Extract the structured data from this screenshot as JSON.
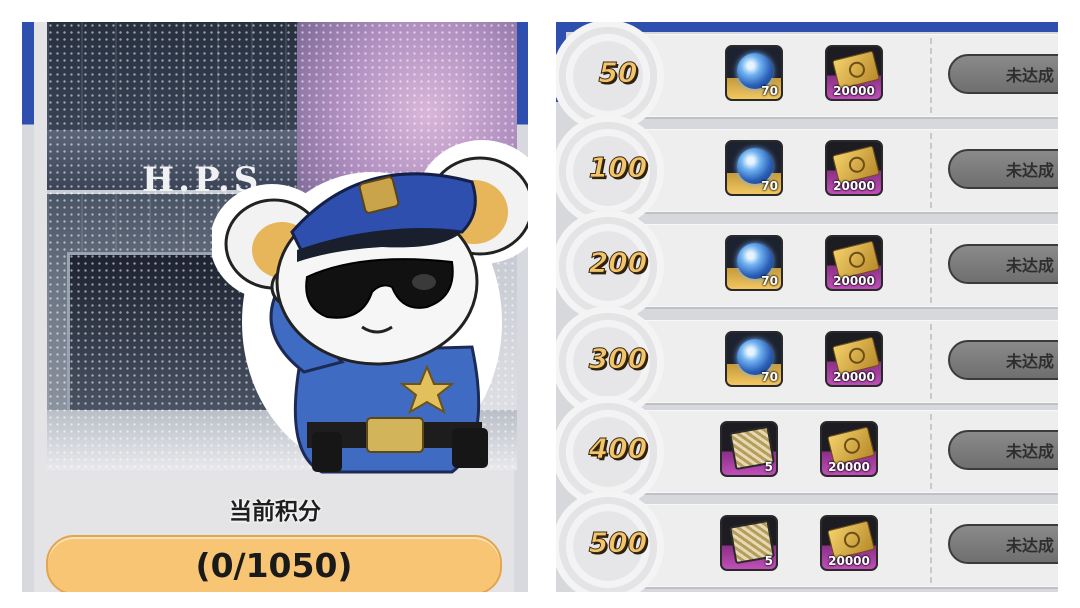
{
  "left": {
    "sign_text": "H.P.S",
    "score_label": "当前积分",
    "score_value": "(0/1050)"
  },
  "milestones": [
    {
      "points": "50",
      "rewards": [
        {
          "icon": "blue-orb-icon",
          "qty": "70"
        },
        {
          "icon": "gold-ticket-icon",
          "qty": "20000"
        }
      ],
      "status": "未达成"
    },
    {
      "points": "100",
      "rewards": [
        {
          "icon": "blue-orb-icon",
          "qty": "70"
        },
        {
          "icon": "gold-ticket-icon",
          "qty": "20000"
        }
      ],
      "status": "未达成"
    },
    {
      "points": "200",
      "rewards": [
        {
          "icon": "blue-orb-icon",
          "qty": "70"
        },
        {
          "icon": "gold-ticket-icon",
          "qty": "20000"
        }
      ],
      "status": "未达成"
    },
    {
      "points": "300",
      "rewards": [
        {
          "icon": "blue-orb-icon",
          "qty": "70"
        },
        {
          "icon": "gold-ticket-icon",
          "qty": "20000"
        }
      ],
      "status": "未达成"
    },
    {
      "points": "400",
      "rewards": [
        {
          "icon": "card-pack-icon",
          "qty": "5"
        },
        {
          "icon": "gold-ticket-icon",
          "qty": "20000"
        }
      ],
      "status": "未达成"
    },
    {
      "points": "500",
      "rewards": [
        {
          "icon": "card-pack-icon",
          "qty": "5"
        },
        {
          "icon": "gold-ticket-icon",
          "qty": "20000"
        }
      ],
      "status": "未达成"
    }
  ],
  "colors": {
    "accent_blue": "#2f4fae",
    "score_fill": "#f7c574",
    "button_gray": "#7a7a7a"
  }
}
